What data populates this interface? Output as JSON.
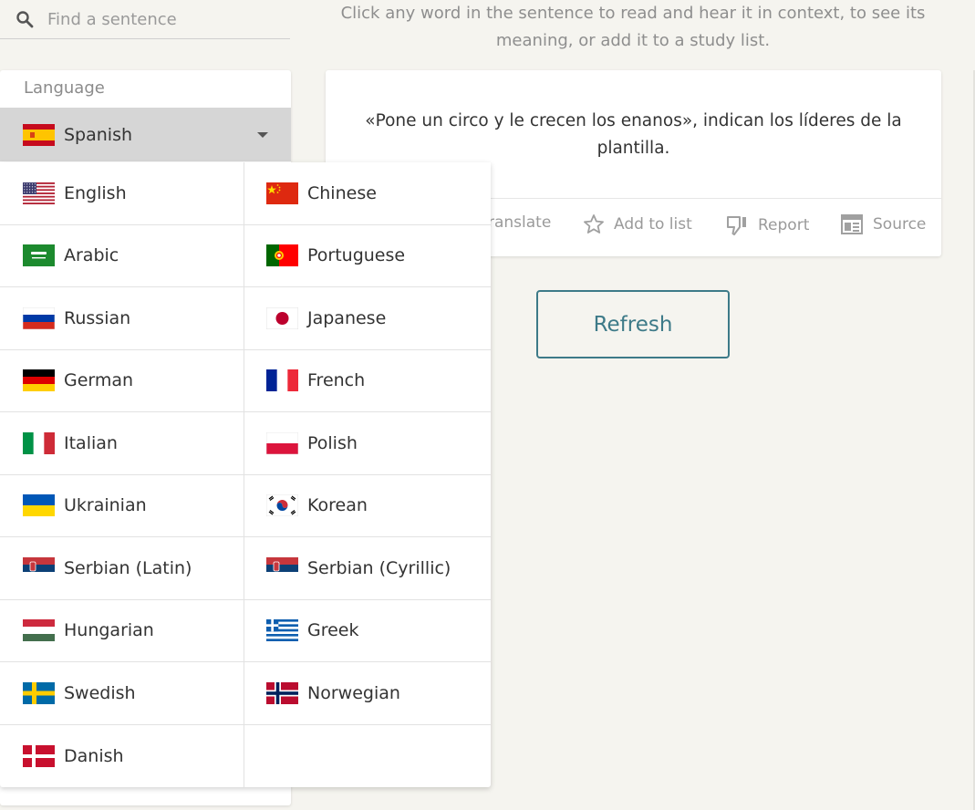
{
  "search": {
    "placeholder": "Find a sentence",
    "icon": "search-icon"
  },
  "instructions": "Click any word in the sentence to read and hear it in context, to see its meaning, or add it to a study list.",
  "language": {
    "label": "Language",
    "selected": {
      "name": "Spanish",
      "flag": "es"
    },
    "options": [
      {
        "name": "English",
        "flag": "us"
      },
      {
        "name": "Chinese",
        "flag": "cn"
      },
      {
        "name": "Arabic",
        "flag": "sa"
      },
      {
        "name": "Portuguese",
        "flag": "pt"
      },
      {
        "name": "Russian",
        "flag": "ru"
      },
      {
        "name": "Japanese",
        "flag": "jp"
      },
      {
        "name": "German",
        "flag": "de"
      },
      {
        "name": "French",
        "flag": "fr"
      },
      {
        "name": "Italian",
        "flag": "it"
      },
      {
        "name": "Polish",
        "flag": "pl"
      },
      {
        "name": "Ukrainian",
        "flag": "ua"
      },
      {
        "name": "Korean",
        "flag": "kr"
      },
      {
        "name": "Serbian (Latin)",
        "flag": "rs"
      },
      {
        "name": "Serbian (Cyrillic)",
        "flag": "rs"
      },
      {
        "name": "Hungarian",
        "flag": "hu"
      },
      {
        "name": "Greek",
        "flag": "gr"
      },
      {
        "name": "Swedish",
        "flag": "se"
      },
      {
        "name": "Norwegian",
        "flag": "no"
      },
      {
        "name": "Danish",
        "flag": "dk"
      }
    ]
  },
  "sentence": "«Pone un circo y le crecen los enanos», indican los líderes de la plantilla.",
  "actions": {
    "translate": "ranslate",
    "add_to_list": "Add to list",
    "report": "Report",
    "source": "Source"
  },
  "refresh_label": "Refresh",
  "colors": {
    "accent": "#3d7a88",
    "selected_bg": "#d6d6d6",
    "page_bg": "#f5f4ef"
  }
}
